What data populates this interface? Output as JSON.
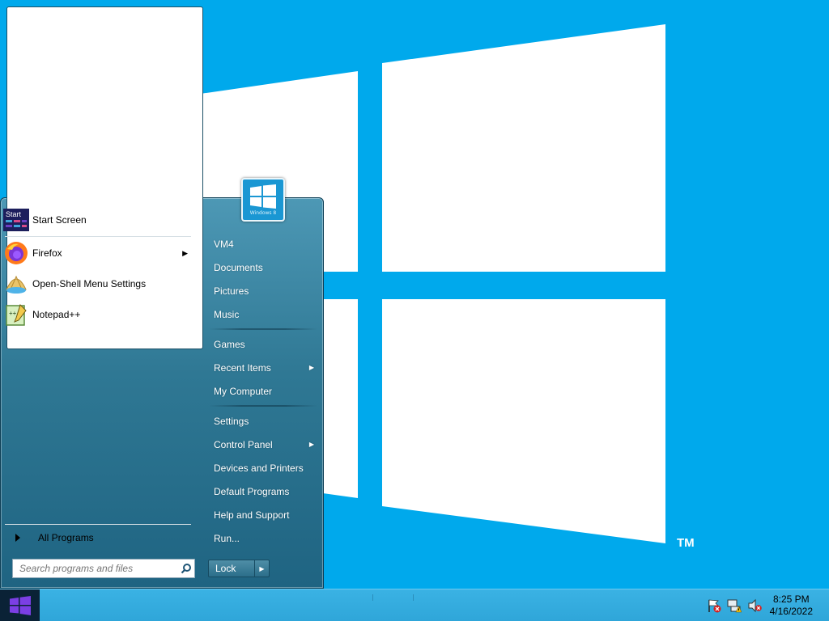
{
  "desktop": {
    "trademark": "TM"
  },
  "start_menu": {
    "pinned": [
      {
        "label": "Start Screen",
        "icon": "start-screen-icon",
        "icon_text": "Start"
      },
      {
        "label": "Firefox",
        "icon": "firefox-icon",
        "has_submenu": true
      },
      {
        "label": "Open-Shell Menu Settings",
        "icon": "open-shell-icon"
      },
      {
        "label": "Notepad++",
        "icon": "notepad-plus-plus-icon"
      }
    ],
    "all_programs": "All Programs",
    "search": {
      "placeholder": "Search programs and files"
    },
    "user_picture_caption": "Windows 8",
    "right_items": [
      {
        "label": "VM4"
      },
      {
        "label": "Documents"
      },
      {
        "label": "Pictures"
      },
      {
        "label": "Music"
      },
      {
        "label": "Games"
      },
      {
        "label": "Recent Items",
        "has_submenu": true
      },
      {
        "label": "My Computer"
      },
      {
        "label": "Settings"
      },
      {
        "label": "Control Panel",
        "has_submenu": true
      },
      {
        "label": "Devices and Printers"
      },
      {
        "label": "Default Programs"
      },
      {
        "label": "Help and Support"
      },
      {
        "label": "Run..."
      }
    ],
    "lock_button": "Lock"
  },
  "taskbar": {
    "tray_icons": [
      "action-center-flag-icon",
      "network-warning-icon",
      "volume-muted-icon"
    ],
    "time": "8:25 PM",
    "date": "4/16/2022"
  },
  "colors": {
    "desktop": "#00a9ec",
    "menu_frame": "#2f7894",
    "taskbar": "#2fa6d9",
    "start_button": "#0a2236"
  }
}
